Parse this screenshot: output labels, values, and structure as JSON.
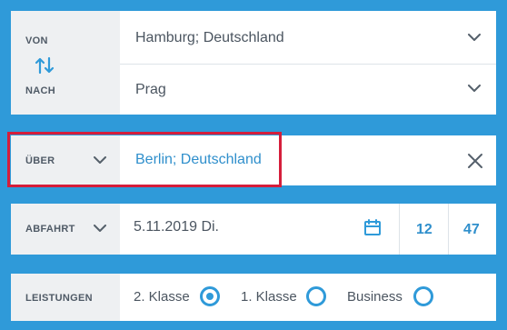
{
  "route": {
    "from_label": "VON",
    "from_value": "Hamburg; Deutschland",
    "to_label": "NACH",
    "to_value": "Prag"
  },
  "via": {
    "label": "ÜBER",
    "value": "Berlin; Deutschland"
  },
  "departure": {
    "label": "ABFAHRT",
    "date": "5.11.2019 Di.",
    "hour": "12",
    "minute": "47"
  },
  "services": {
    "label": "LEISTUNGEN",
    "options": [
      {
        "label": "2. Klasse",
        "selected": true
      },
      {
        "label": "1. Klasse",
        "selected": false
      },
      {
        "label": "Business",
        "selected": false
      }
    ]
  },
  "colors": {
    "accent": "#2f9ad9",
    "highlight": "#d51e3b"
  }
}
